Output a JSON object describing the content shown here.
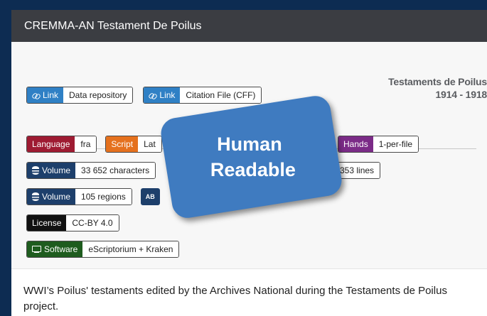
{
  "header": {
    "title": "CREMMA-AN Testament De Poilus"
  },
  "banner": {
    "line1": "Testaments de Poilus",
    "line2": "1914 - 1918"
  },
  "links": [
    {
      "key": "Link",
      "value": "Data repository"
    },
    {
      "key": "Link",
      "value": "Citation File (CFF)"
    }
  ],
  "meta": {
    "language": {
      "key": "Language",
      "value": "fra"
    },
    "script": {
      "key": "Script",
      "value": "Lat"
    },
    "hands": {
      "key": "Hands",
      "value": "1-per-file"
    },
    "volume_chars": {
      "key": "Volume",
      "value": "33 652 characters"
    },
    "volume_lines": {
      "value": "353 lines"
    },
    "volume_regions": {
      "key": "Volume",
      "value": "105 regions"
    },
    "segment_icon": {
      "value": "AB"
    },
    "license": {
      "key": "License",
      "value": "CC-BY 4.0"
    },
    "software": {
      "key": "Software",
      "value": "eScriptorium + Kraken"
    }
  },
  "callout": {
    "line1": "Human",
    "line2": "Readable"
  },
  "description": "WWI’s Poilus' testaments edited by the Archives National during the Testaments de Poilus project.",
  "colors": {
    "link": "#2f80c5",
    "language": "#9e1b32",
    "script": "#e5711e",
    "hands": "#7b2b87",
    "volume": "#1d3f6b",
    "license": "#111111",
    "software": "#1e5c1e",
    "callout": "#3f7bc0"
  }
}
